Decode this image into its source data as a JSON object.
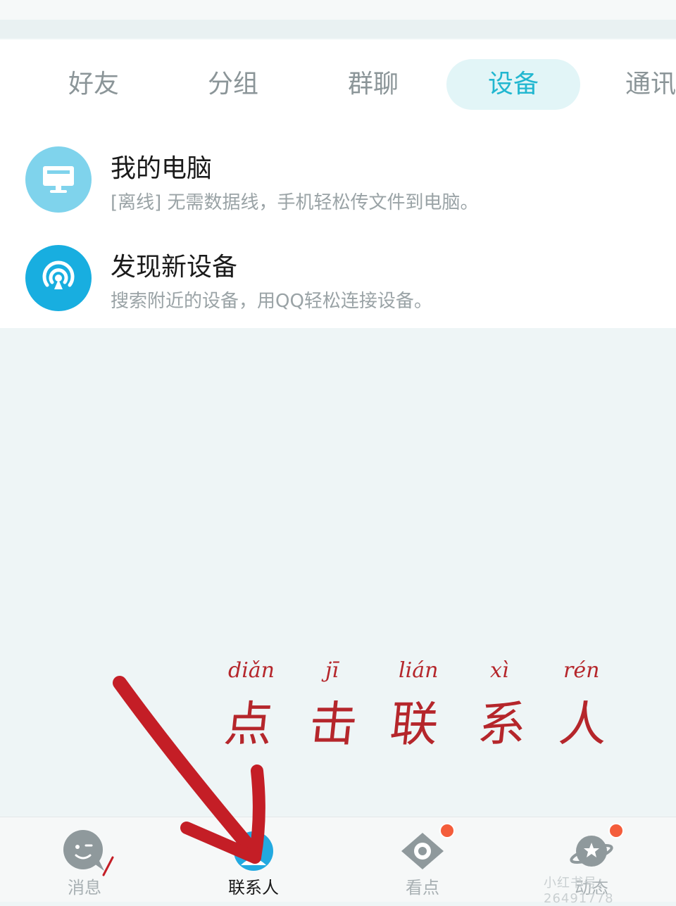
{
  "tabs": [
    {
      "label": "好友",
      "active": false
    },
    {
      "label": "分组",
      "active": false
    },
    {
      "label": "群聊",
      "active": false
    },
    {
      "label": "设备",
      "active": true
    },
    {
      "label": "通讯",
      "active": false
    }
  ],
  "devices": [
    {
      "title": "我的电脑",
      "desc": "[离线] 无需数据线，手机轻松传文件到电脑。",
      "icon": "monitor-icon"
    },
    {
      "title": "发现新设备",
      "desc": "搜索附近的设备，用QQ轻松连接设备。",
      "icon": "radar-icon"
    }
  ],
  "annotation": {
    "pinyin": [
      "diǎn",
      "jī",
      "lián",
      "xì",
      "rén"
    ],
    "hanzi": [
      "点",
      "击",
      "联",
      "系",
      "人"
    ],
    "color": "#b5262b"
  },
  "bottom_nav": [
    {
      "label": "消息",
      "icon": "chat-bubble-icon",
      "active": false,
      "badge": false
    },
    {
      "label": "联系人",
      "icon": "contacts-icon",
      "active": true,
      "badge": false
    },
    {
      "label": "看点",
      "icon": "eye-icon",
      "active": false,
      "badge": true
    },
    {
      "label": "动态",
      "icon": "planet-icon",
      "active": false,
      "badge": true
    }
  ],
  "watermark": "小红书号：26491778",
  "colors": {
    "accent": "#22b7d0",
    "badge": "#f45d3b",
    "annotation": "#b5262b"
  }
}
